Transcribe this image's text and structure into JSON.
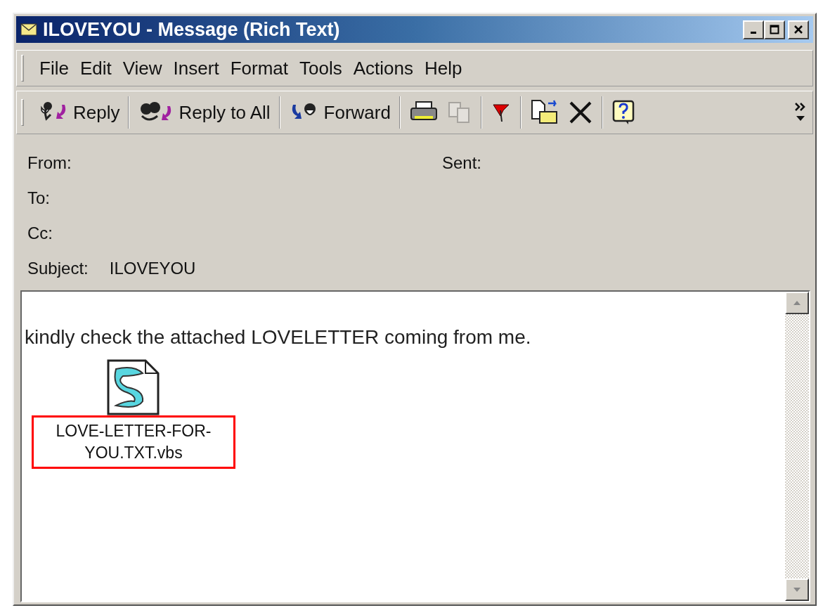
{
  "window": {
    "title": "ILOVEYOU - Message (Rich Text)"
  },
  "menu": [
    "File",
    "Edit",
    "View",
    "Insert",
    "Format",
    "Tools",
    "Actions",
    "Help"
  ],
  "toolbar": [
    [
      {
        "kind": "reply",
        "label": "Reply",
        "disabled": false
      }
    ],
    [
      {
        "kind": "reply-all",
        "label": "Reply to All",
        "disabled": false
      }
    ],
    [
      {
        "kind": "forward",
        "label": "Forward",
        "disabled": false
      }
    ],
    [
      {
        "kind": "print",
        "disabled": false
      },
      {
        "kind": "copy",
        "disabled": true
      }
    ],
    [
      {
        "kind": "flag",
        "disabled": false
      }
    ],
    [
      {
        "kind": "move",
        "disabled": false
      },
      {
        "kind": "delete",
        "disabled": false
      }
    ],
    [
      {
        "kind": "help",
        "disabled": false
      }
    ]
  ],
  "header": [
    {
      "fields": [
        {
          "label": "From:"
        },
        {
          "label": "Sent:"
        }
      ]
    },
    {
      "fields": [
        {
          "label": "To:"
        }
      ]
    },
    {
      "fields": [
        {
          "label": "Cc:"
        }
      ]
    },
    {
      "fields": [
        {
          "label": "Subject:",
          "value": "ILOVEYOU"
        }
      ]
    }
  ],
  "body": {
    "text": "kindly check the attached LOVELETTER coming from me.",
    "attachment": {
      "name": "LOVE-LETTER-FOR-YOU.TXT.vbs",
      "highlighted": true
    }
  }
}
